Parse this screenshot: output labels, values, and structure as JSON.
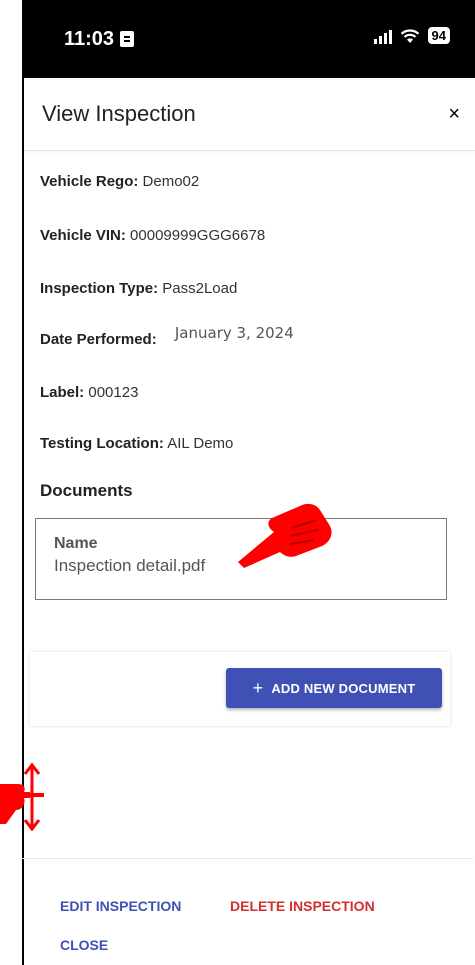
{
  "status_bar": {
    "time": "11:03",
    "battery": "94"
  },
  "modal": {
    "title": "View Inspection",
    "close_symbol": "×"
  },
  "fields": [
    {
      "label": "Vehicle Rego:",
      "value": "Demo02"
    },
    {
      "label": "Vehicle VIN:",
      "value": "00009999GGG6678"
    },
    {
      "label": "Inspection Type:",
      "value": "Pass2Load"
    },
    {
      "label": "Date Performed:",
      "value": "January 3, 2024"
    },
    {
      "label": "Label:",
      "value": "000123"
    },
    {
      "label": "Testing Location:",
      "value": "AIL Demo"
    }
  ],
  "documents": {
    "title": "Documents",
    "header": "Name",
    "file_name": "Inspection detail.pdf",
    "add_button": "ADD NEW DOCUMENT",
    "add_icon": "+"
  },
  "actions": {
    "edit": "EDIT INSPECTION",
    "delete": "DELETE INSPECTION",
    "close": "CLOSE"
  },
  "colors": {
    "primary": "#3f51b5",
    "danger": "#d32f2f",
    "annotation": "#ff0000"
  },
  "annotations": {
    "pointer_icon": "hand-pointer-icon",
    "resize_icon": "hand-resize-vertical-icon"
  }
}
